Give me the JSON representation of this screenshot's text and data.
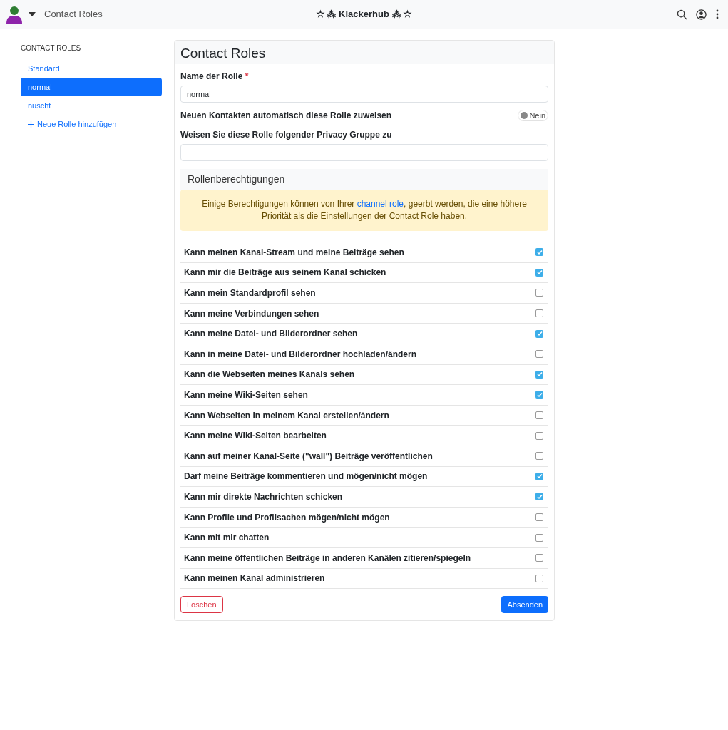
{
  "navbar": {
    "page_title": "Contact Roles",
    "site_name": "✫ ⁂ Klackerhub ⁂ ✫"
  },
  "sidebar": {
    "heading": "CONTACT ROLES",
    "items": [
      {
        "label": "Standard",
        "selected": false
      },
      {
        "label": "normal",
        "selected": true
      },
      {
        "label": "nüscht",
        "selected": false
      }
    ],
    "add_link": "Neue Rolle hinzufügen"
  },
  "form": {
    "title": "Contact Roles",
    "name_label": "Name der Rolle",
    "required_mark": "*",
    "name_value": "normal",
    "auto_assign_label": "Neuen Kontakten automatisch diese Rolle zuweisen",
    "auto_assign": {
      "on": false,
      "text": "Nein"
    },
    "privacy_group_label": "Weisen Sie diese Rolle folgender Privacy Gruppe zu",
    "permissions_heading": "Rollenberechtigungen",
    "notice": {
      "before": "Einige Berechtigungen können von Ihrer",
      "link": "channel role",
      "after": ", geerbt werden, die eine höhere Priorität als die Einstellungen der Contact Role haben."
    },
    "permissions": [
      {
        "label": "Kann meinen Kanal-Stream und meine Beiträge sehen",
        "checked": true
      },
      {
        "label": "Kann mir die Beiträge aus seinem Kanal schicken",
        "checked": true
      },
      {
        "label": "Kann mein Standardprofil sehen",
        "checked": false
      },
      {
        "label": "Kann meine Verbindungen sehen",
        "checked": false
      },
      {
        "label": "Kann meine Datei- und Bilderordner sehen",
        "checked": true
      },
      {
        "label": "Kann in meine Datei- und Bilderordner hochladen/ändern",
        "checked": false
      },
      {
        "label": "Kann die Webseiten meines Kanals sehen",
        "checked": true
      },
      {
        "label": "Kann meine Wiki-Seiten sehen",
        "checked": true
      },
      {
        "label": "Kann Webseiten in meinem Kanal erstellen/ändern",
        "checked": false
      },
      {
        "label": "Kann meine Wiki-Seiten bearbeiten",
        "checked": false
      },
      {
        "label": "Kann auf meiner Kanal-Seite (\"wall\") Beiträge veröffentlichen",
        "checked": false
      },
      {
        "label": "Darf meine Beiträge kommentieren und mögen/nicht mögen",
        "checked": true
      },
      {
        "label": "Kann mir direkte Nachrichten schicken",
        "checked": true
      },
      {
        "label": "Kann Profile und Profilsachen mögen/nicht mögen",
        "checked": false
      },
      {
        "label": "Kann mit mir chatten",
        "checked": false
      },
      {
        "label": "Kann meine öffentlichen Beiträge in anderen Kanälen zitieren/spiegeln",
        "checked": false
      },
      {
        "label": "Kann meinen Kanal administrieren",
        "checked": false
      }
    ],
    "delete_button": "Löschen",
    "submit_button": "Absenden"
  }
}
